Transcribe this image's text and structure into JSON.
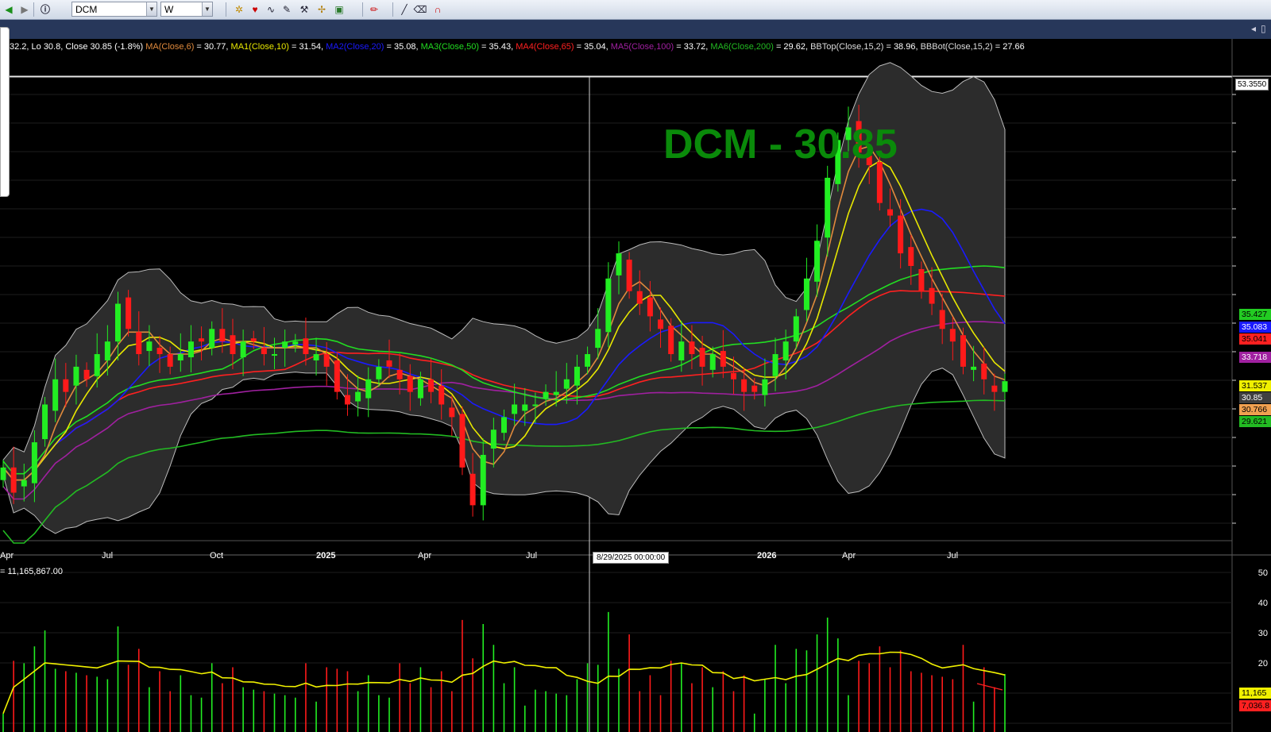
{
  "toolbar": {
    "symbol": "DCM",
    "interval": "W",
    "icons": [
      "back-icon",
      "forward-icon",
      "info-icon",
      "scan-icon",
      "heart-icon",
      "indicator-icon",
      "draw-icon",
      "tool-icon",
      "zoom-icon",
      "fill-icon",
      "pen-icon",
      "line-icon",
      "erase-icon",
      "magnet-icon"
    ]
  },
  "tabbar": {
    "nav_left": "◂",
    "nav_right": "▯"
  },
  "legend": {
    "ohlc": "32.2, Lo 30.8, Close 30.85 (-1.8%)",
    "items": [
      {
        "label": "MA(Close,6)",
        "value": " = 30.77,",
        "color": "#e08a3c"
      },
      {
        "label": "MA1(Close,10)",
        "value": " = 31.54,",
        "color": "#e8e800"
      },
      {
        "label": "MA2(Close,20)",
        "value": " = 35.08,",
        "color": "#1a1aff"
      },
      {
        "label": "MA3(Close,50)",
        "value": " = 35.43,",
        "color": "#22dd22"
      },
      {
        "label": "MA4(Close,65)",
        "value": " = 35.04,",
        "color": "#ff2020"
      },
      {
        "label": "MA5(Close,100)",
        "value": " = 33.72,",
        "color": "#a020a0"
      },
      {
        "label": "MA6(Close,200)",
        "value": " = 29.62,",
        "color": "#22bb22"
      },
      {
        "label": "BBTop(Close,15,2)",
        "value": " = 38.96,",
        "color": "#dddddd"
      },
      {
        "label": "BBBot(Close,15,2)",
        "value": " = 27.66",
        "color": "#dddddd"
      }
    ]
  },
  "title_overlay": "DCM - 30.85",
  "crosshair": {
    "date": "8/29/2025 00:00:00",
    "price": "53.3550"
  },
  "x_axis_labels": [
    "Apr",
    "Jul",
    "Oct",
    "2025",
    "Apr",
    "Jul",
    "2026",
    "Apr",
    "Jul"
  ],
  "price_tags": [
    {
      "text": "35.427",
      "bg": "#22cc22",
      "fg": "#000000"
    },
    {
      "text": "35.083",
      "bg": "#1a1aff",
      "fg": "#ffffff"
    },
    {
      "text": "35.041",
      "bg": "#ff2020",
      "fg": "#000000"
    },
    {
      "text": "33.718",
      "bg": "#a020a0",
      "fg": "#ffffff"
    },
    {
      "text": "31.537",
      "bg": "#f0f000",
      "fg": "#000000"
    },
    {
      "text": "30.85",
      "bg": "#404040",
      "fg": "#ffffff"
    },
    {
      "text": "30.766",
      "bg": "#f0a050",
      "fg": "#000000"
    },
    {
      "text": "29.621",
      "bg": "#22bb22",
      "fg": "#000000"
    }
  ],
  "volume": {
    "info": "= 11,165,867.00",
    "tick_labels": [
      "50",
      "40",
      "30",
      "20"
    ],
    "tags": [
      {
        "text": "11,165",
        "bg": "#f0f000",
        "fg": "#000000"
      },
      {
        "text": "7,036.8",
        "bg": "#ff2020",
        "fg": "#000000"
      }
    ]
  },
  "colors": {
    "up": "#22ee22",
    "down": "#ff1a1a",
    "band": "#2c2c2c",
    "grid": "#222222"
  },
  "chart_data": {
    "type": "candlestick",
    "title": "DCM - 30.85",
    "interval": "weekly",
    "ylim_price": [
      18,
      55
    ],
    "series_close_approx": [
      24,
      22,
      23,
      26,
      29,
      31,
      30,
      32,
      31,
      33,
      34,
      37,
      35,
      33,
      34,
      33,
      32,
      33,
      34,
      34,
      35,
      34,
      33,
      34,
      34,
      33,
      33,
      34,
      34,
      33,
      33,
      32,
      30,
      29,
      30,
      31,
      32,
      32,
      31,
      30,
      31,
      30,
      29,
      28,
      24,
      21,
      25,
      27,
      28,
      29,
      29,
      29,
      30,
      30,
      31,
      32,
      33,
      35,
      39,
      41,
      38,
      37,
      36,
      35,
      33,
      34,
      33,
      32,
      33,
      32,
      31,
      30,
      30,
      31,
      33,
      34,
      36,
      39,
      42,
      47,
      50,
      51,
      49,
      48,
      45,
      44,
      41,
      40,
      38,
      37,
      35,
      34,
      32,
      32,
      31,
      30,
      30.85
    ]
  }
}
